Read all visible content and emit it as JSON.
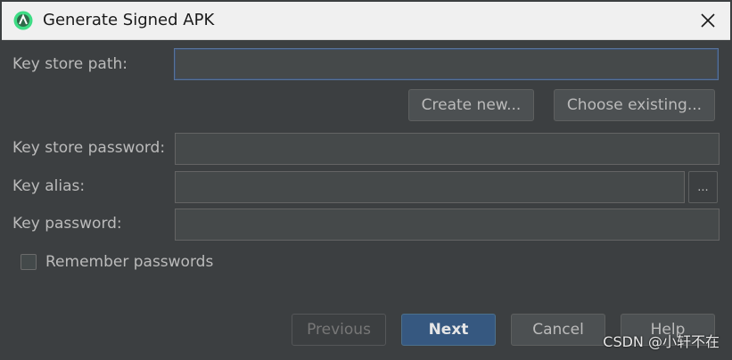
{
  "window": {
    "title": "Generate Signed APK",
    "close_icon": "close-icon"
  },
  "form": {
    "key_store_path": {
      "label": "Key store path:",
      "value": ""
    },
    "create_new_label": "Create new...",
    "choose_existing_label": "Choose existing...",
    "key_store_password": {
      "label": "Key store password:",
      "value": ""
    },
    "key_alias": {
      "label": "Key alias:",
      "value": "",
      "browse_label": "..."
    },
    "key_password": {
      "label": "Key password:",
      "value": ""
    },
    "remember_passwords": {
      "label": "Remember passwords",
      "checked": false
    }
  },
  "footer": {
    "previous_label": "Previous",
    "next_label": "Next",
    "cancel_label": "Cancel",
    "help_label": "Help"
  },
  "watermark": "CSDN @小轩不在",
  "colors": {
    "background": "#3c3f41",
    "primary_button": "#365880",
    "focus_border": "#58739a"
  }
}
